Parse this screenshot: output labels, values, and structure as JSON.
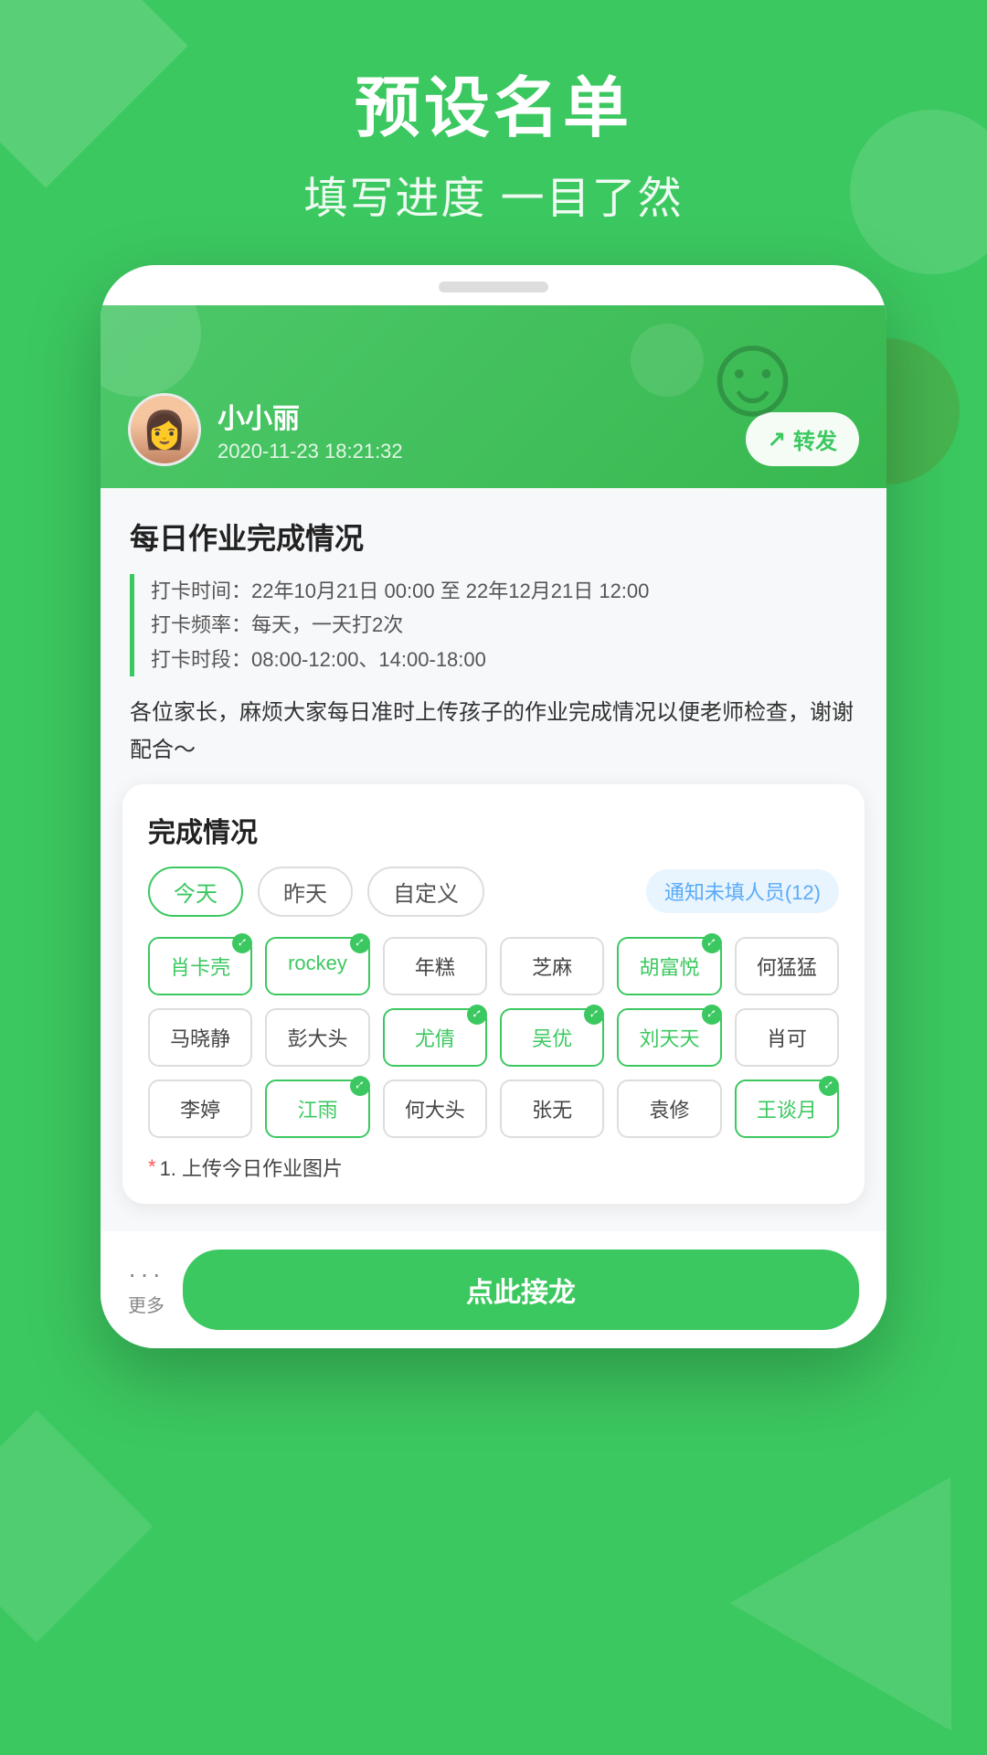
{
  "background": {
    "color": "#3CC860"
  },
  "header": {
    "main_title": "预设名单",
    "sub_title": "填写进度 一目了然"
  },
  "card": {
    "author": {
      "name": "小小丽",
      "time": "2020-11-23 18:21:32",
      "avatar_emoji": "👩"
    },
    "forward_label": "转发",
    "section_title": "每日作业完成情况",
    "info_lines": [
      "打卡时间：22年10月21日 00:00 至 22年12月21日 12:00",
      "打卡频率：每天，一天打2次",
      "打卡时段：08:00-12:00、14:00-18:00"
    ],
    "description": "各位家长，麻烦大家每日准时上传孩子的作业完成情况以便老师检查，谢谢配合～",
    "completion": {
      "title": "完成情况",
      "filters": [
        {
          "label": "今天",
          "active": true
        },
        {
          "label": "昨天",
          "active": false
        },
        {
          "label": "自定义",
          "active": false
        }
      ],
      "notify_btn": "通知未填人员(12)",
      "names": [
        {
          "label": "肖卡壳",
          "checked": true
        },
        {
          "label": "rockey",
          "checked": true
        },
        {
          "label": "年糕",
          "checked": false
        },
        {
          "label": "芝麻",
          "checked": false
        },
        {
          "label": "胡富悦",
          "checked": true
        },
        {
          "label": "何猛猛",
          "checked": false
        },
        {
          "label": "马晓静",
          "checked": false
        },
        {
          "label": "彭大头",
          "checked": false
        },
        {
          "label": "尤倩",
          "checked": true
        },
        {
          "label": "吴优",
          "checked": true
        },
        {
          "label": "刘天天",
          "checked": true
        },
        {
          "label": "肖可",
          "checked": false
        },
        {
          "label": "李婷",
          "checked": false
        },
        {
          "label": "江雨",
          "checked": true
        },
        {
          "label": "何大头",
          "checked": false
        },
        {
          "label": "张无",
          "checked": false
        },
        {
          "label": "袁修",
          "checked": false
        },
        {
          "label": "王谈月",
          "checked": true
        }
      ]
    },
    "required_field": "1. 上传今日作业图片",
    "bottom": {
      "more_dots": "···",
      "more_label": "更多",
      "action_label": "点此接龙"
    }
  }
}
